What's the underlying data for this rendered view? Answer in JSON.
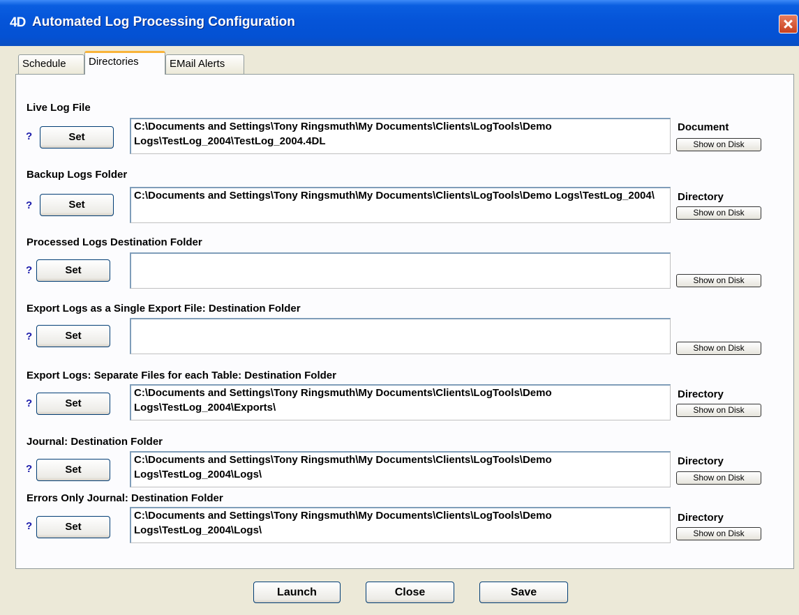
{
  "window": {
    "app_icon": "4D",
    "title": "Automated Log Processing Configuration"
  },
  "tabs": [
    {
      "label": "Schedule",
      "active": false
    },
    {
      "label": "Directories",
      "active": true
    },
    {
      "label": "EMail Alerts",
      "active": false
    }
  ],
  "sections": [
    {
      "label": "Live Log File",
      "help": "?",
      "set_label": "Set",
      "path": "C:\\Documents and Settings\\Tony Ringsmuth\\My Documents\\Clients\\LogTools\\Demo Logs\\TestLog_2004\\TestLog_2004.4DL",
      "type": "Document",
      "show_label": "Show on Disk"
    },
    {
      "label": "Backup Logs Folder",
      "help": "?",
      "set_label": "Set",
      "path": "C:\\Documents and Settings\\Tony Ringsmuth\\My Documents\\Clients\\LogTools\\Demo Logs\\TestLog_2004\\",
      "type": "Directory",
      "show_label": "Show on Disk"
    },
    {
      "label": "Processed Logs Destination Folder",
      "help": "?",
      "set_label": "Set",
      "path": "",
      "type": "",
      "show_label": "Show on Disk"
    },
    {
      "label": "Export Logs as a Single Export File: Destination Folder",
      "help": "?",
      "set_label": "Set",
      "path": "",
      "type": "",
      "show_label": "Show on Disk"
    },
    {
      "label": "Export Logs: Separate Files for each Table: Destination Folder",
      "help": "?",
      "set_label": "Set",
      "path": "C:\\Documents and Settings\\Tony Ringsmuth\\My Documents\\Clients\\LogTools\\Demo Logs\\TestLog_2004\\Exports\\",
      "type": "Directory",
      "show_label": "Show on Disk"
    },
    {
      "label": "Journal: Destination Folder",
      "help": "?",
      "set_label": "Set",
      "path": "C:\\Documents and Settings\\Tony Ringsmuth\\My Documents\\Clients\\LogTools\\Demo Logs\\TestLog_2004\\Logs\\",
      "type": "Directory",
      "show_label": "Show on Disk"
    },
    {
      "label": "Errors Only Journal: Destination Folder",
      "help": "?",
      "set_label": "Set",
      "path": "C:\\Documents and Settings\\Tony Ringsmuth\\My Documents\\Clients\\LogTools\\Demo Logs\\TestLog_2004\\Logs\\",
      "type": "Directory",
      "show_label": "Show on Disk"
    }
  ],
  "footer": {
    "launch_label": "Launch",
    "close_label": "Close",
    "save_label": "Save"
  }
}
